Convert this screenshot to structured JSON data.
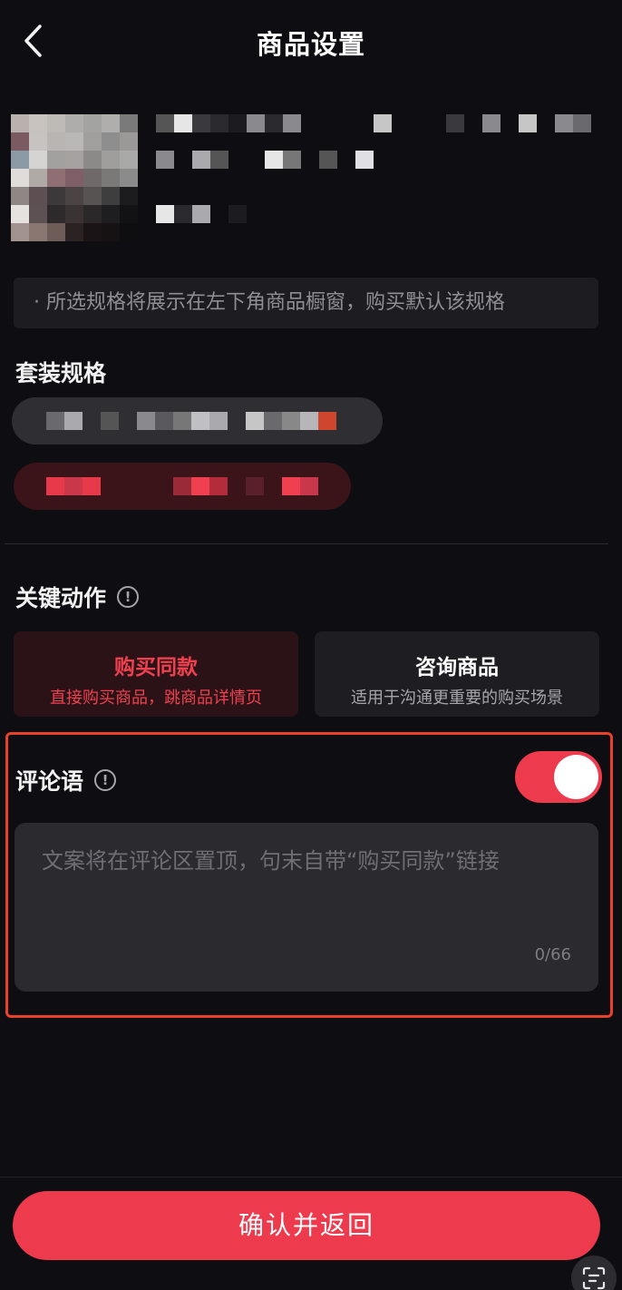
{
  "header": {
    "title": "商品设置",
    "back_icon": "chevron-left-icon"
  },
  "notice": {
    "text": "· 所选规格将展示在左下角商品橱窗，购买默认该规格"
  },
  "spec_section": {
    "title": "套装规格"
  },
  "key_action": {
    "title": "关键动作",
    "info_icon": "info-icon",
    "options": [
      {
        "title": "购买同款",
        "desc": "直接购买商品，跳商品详情页",
        "selected": true
      },
      {
        "title": "咨询商品",
        "desc": "适用于沟通更重要的购买场景",
        "selected": false
      }
    ]
  },
  "comment": {
    "title": "评论语",
    "toggle_on": true,
    "placeholder": "文案将在评论区置顶，句末自带“购买同款”链接",
    "counter": "0/66"
  },
  "footer": {
    "confirm_label": "确认并返回",
    "scan_icon": "scan-text-icon"
  },
  "colors": {
    "accent": "#ee3a4d",
    "background": "#0e0e12",
    "highlight_border": "#e8402a"
  }
}
